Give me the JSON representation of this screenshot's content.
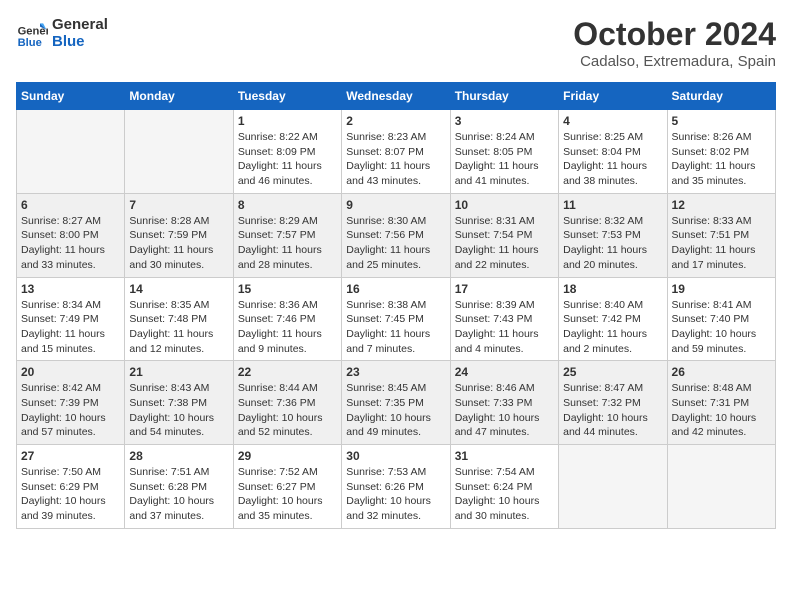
{
  "logo": {
    "line1": "General",
    "line2": "Blue"
  },
  "title": "October 2024",
  "location": "Cadalso, Extremadura, Spain",
  "days_of_week": [
    "Sunday",
    "Monday",
    "Tuesday",
    "Wednesday",
    "Thursday",
    "Friday",
    "Saturday"
  ],
  "weeks": [
    [
      {
        "day": "",
        "info": ""
      },
      {
        "day": "",
        "info": ""
      },
      {
        "day": "1",
        "info": "Sunrise: 8:22 AM\nSunset: 8:09 PM\nDaylight: 11 hours and 46 minutes."
      },
      {
        "day": "2",
        "info": "Sunrise: 8:23 AM\nSunset: 8:07 PM\nDaylight: 11 hours and 43 minutes."
      },
      {
        "day": "3",
        "info": "Sunrise: 8:24 AM\nSunset: 8:05 PM\nDaylight: 11 hours and 41 minutes."
      },
      {
        "day": "4",
        "info": "Sunrise: 8:25 AM\nSunset: 8:04 PM\nDaylight: 11 hours and 38 minutes."
      },
      {
        "day": "5",
        "info": "Sunrise: 8:26 AM\nSunset: 8:02 PM\nDaylight: 11 hours and 35 minutes."
      }
    ],
    [
      {
        "day": "6",
        "info": "Sunrise: 8:27 AM\nSunset: 8:00 PM\nDaylight: 11 hours and 33 minutes."
      },
      {
        "day": "7",
        "info": "Sunrise: 8:28 AM\nSunset: 7:59 PM\nDaylight: 11 hours and 30 minutes."
      },
      {
        "day": "8",
        "info": "Sunrise: 8:29 AM\nSunset: 7:57 PM\nDaylight: 11 hours and 28 minutes."
      },
      {
        "day": "9",
        "info": "Sunrise: 8:30 AM\nSunset: 7:56 PM\nDaylight: 11 hours and 25 minutes."
      },
      {
        "day": "10",
        "info": "Sunrise: 8:31 AM\nSunset: 7:54 PM\nDaylight: 11 hours and 22 minutes."
      },
      {
        "day": "11",
        "info": "Sunrise: 8:32 AM\nSunset: 7:53 PM\nDaylight: 11 hours and 20 minutes."
      },
      {
        "day": "12",
        "info": "Sunrise: 8:33 AM\nSunset: 7:51 PM\nDaylight: 11 hours and 17 minutes."
      }
    ],
    [
      {
        "day": "13",
        "info": "Sunrise: 8:34 AM\nSunset: 7:49 PM\nDaylight: 11 hours and 15 minutes."
      },
      {
        "day": "14",
        "info": "Sunrise: 8:35 AM\nSunset: 7:48 PM\nDaylight: 11 hours and 12 minutes."
      },
      {
        "day": "15",
        "info": "Sunrise: 8:36 AM\nSunset: 7:46 PM\nDaylight: 11 hours and 9 minutes."
      },
      {
        "day": "16",
        "info": "Sunrise: 8:38 AM\nSunset: 7:45 PM\nDaylight: 11 hours and 7 minutes."
      },
      {
        "day": "17",
        "info": "Sunrise: 8:39 AM\nSunset: 7:43 PM\nDaylight: 11 hours and 4 minutes."
      },
      {
        "day": "18",
        "info": "Sunrise: 8:40 AM\nSunset: 7:42 PM\nDaylight: 11 hours and 2 minutes."
      },
      {
        "day": "19",
        "info": "Sunrise: 8:41 AM\nSunset: 7:40 PM\nDaylight: 10 hours and 59 minutes."
      }
    ],
    [
      {
        "day": "20",
        "info": "Sunrise: 8:42 AM\nSunset: 7:39 PM\nDaylight: 10 hours and 57 minutes."
      },
      {
        "day": "21",
        "info": "Sunrise: 8:43 AM\nSunset: 7:38 PM\nDaylight: 10 hours and 54 minutes."
      },
      {
        "day": "22",
        "info": "Sunrise: 8:44 AM\nSunset: 7:36 PM\nDaylight: 10 hours and 52 minutes."
      },
      {
        "day": "23",
        "info": "Sunrise: 8:45 AM\nSunset: 7:35 PM\nDaylight: 10 hours and 49 minutes."
      },
      {
        "day": "24",
        "info": "Sunrise: 8:46 AM\nSunset: 7:33 PM\nDaylight: 10 hours and 47 minutes."
      },
      {
        "day": "25",
        "info": "Sunrise: 8:47 AM\nSunset: 7:32 PM\nDaylight: 10 hours and 44 minutes."
      },
      {
        "day": "26",
        "info": "Sunrise: 8:48 AM\nSunset: 7:31 PM\nDaylight: 10 hours and 42 minutes."
      }
    ],
    [
      {
        "day": "27",
        "info": "Sunrise: 7:50 AM\nSunset: 6:29 PM\nDaylight: 10 hours and 39 minutes."
      },
      {
        "day": "28",
        "info": "Sunrise: 7:51 AM\nSunset: 6:28 PM\nDaylight: 10 hours and 37 minutes."
      },
      {
        "day": "29",
        "info": "Sunrise: 7:52 AM\nSunset: 6:27 PM\nDaylight: 10 hours and 35 minutes."
      },
      {
        "day": "30",
        "info": "Sunrise: 7:53 AM\nSunset: 6:26 PM\nDaylight: 10 hours and 32 minutes."
      },
      {
        "day": "31",
        "info": "Sunrise: 7:54 AM\nSunset: 6:24 PM\nDaylight: 10 hours and 30 minutes."
      },
      {
        "day": "",
        "info": ""
      },
      {
        "day": "",
        "info": ""
      }
    ]
  ]
}
